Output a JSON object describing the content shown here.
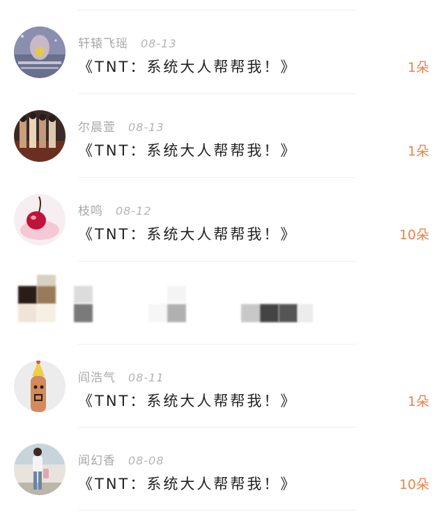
{
  "colors": {
    "count": "#e8834a",
    "title": "#222222",
    "meta": "#a8a8a8",
    "divider": "#efefef"
  },
  "comments": [
    {
      "name": "轩辕飞瑶",
      "date": "08-13",
      "title": "《TNT：系统大人帮帮我！》",
      "count": "1朵",
      "avatar": "avatar-glitter-selfie"
    },
    {
      "name": "尔晨萱",
      "date": "08-13",
      "title": "《TNT：系统大人帮帮我！》",
      "count": "1朵",
      "avatar": "avatar-group-photo"
    },
    {
      "name": "枝鸣",
      "date": "08-12",
      "title": "《TNT：系统大人帮帮我！》",
      "count": "10朵",
      "avatar": "avatar-cherry"
    },
    {
      "name": "阎浩气",
      "date": "08-11",
      "title": "《TNT：系统大人帮帮我！》",
      "count": "1朵",
      "avatar": "avatar-party-hat"
    },
    {
      "name": "闻幻香",
      "date": "08-08",
      "title": "《TNT：系统大人帮帮我！》",
      "count": "10朵",
      "avatar": "avatar-person-standing"
    }
  ]
}
